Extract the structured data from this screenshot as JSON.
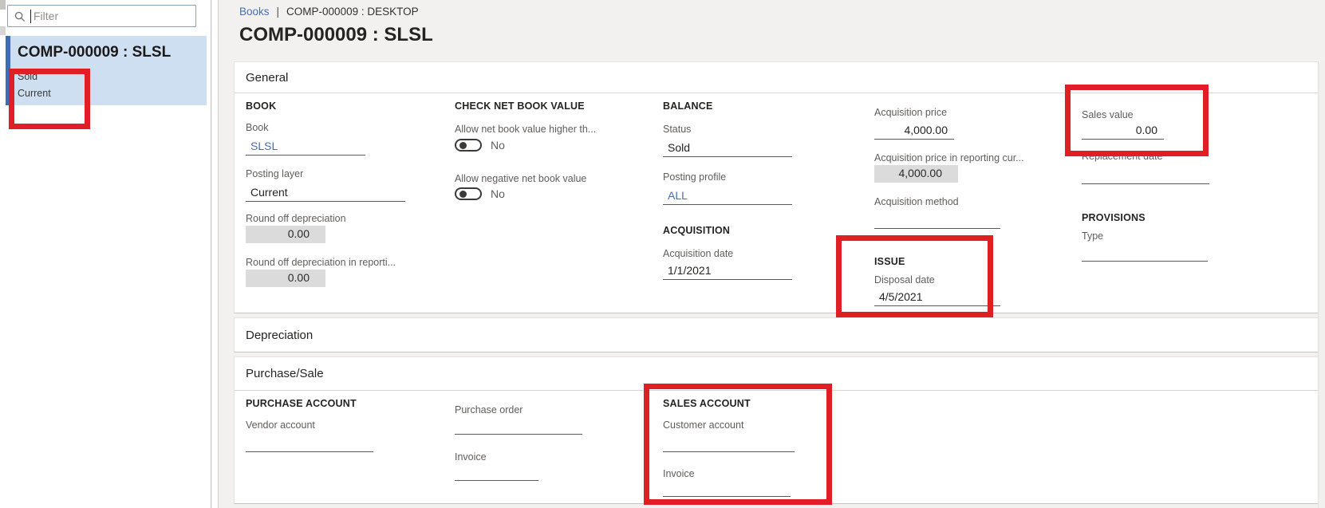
{
  "sidebar": {
    "filter_placeholder": "Filter",
    "selected_item": {
      "title": "COMP-000009 : SLSL",
      "status": "Sold",
      "layer": "Current"
    }
  },
  "header": {
    "breadcrumb_link": "Books",
    "breadcrumb_separator": "|",
    "breadcrumb_current": "COMP-000009 : DESKTOP",
    "page_title": "COMP-000009 : SLSL"
  },
  "general": {
    "title": "General",
    "book_header": "BOOK",
    "book_label": "Book",
    "book_value": "SLSL",
    "posting_layer_label": "Posting layer",
    "posting_layer_value": "Current",
    "round_off_label": "Round off depreciation",
    "round_off_value": "0.00",
    "round_off_reporting_label": "Round off depreciation in reporti...",
    "round_off_reporting_value": "0.00",
    "check_nbv_header": "CHECK NET BOOK VALUE",
    "allow_higher_label": "Allow net book value higher th...",
    "allow_higher_value": "No",
    "allow_negative_label": "Allow negative net book value",
    "allow_negative_value": "No",
    "balance_header": "BALANCE",
    "status_label": "Status",
    "status_value": "Sold",
    "posting_profile_label": "Posting profile",
    "posting_profile_value": "ALL",
    "acquisition_header": "ACQUISITION",
    "acquisition_date_label": "Acquisition date",
    "acquisition_date_value": "1/1/2021",
    "acquisition_price_label": "Acquisition price",
    "acquisition_price_value": "4,000.00",
    "acquisition_price_reporting_label": "Acquisition price in reporting cur...",
    "acquisition_price_reporting_value": "4,000.00",
    "acquisition_method_label": "Acquisition method",
    "issue_header": "ISSUE",
    "disposal_date_label": "Disposal date",
    "disposal_date_value": "4/5/2021",
    "sales_value_label": "Sales value",
    "sales_value_value": "0.00",
    "replacement_date_label": "Replacement date",
    "provisions_header": "PROVISIONS",
    "type_label": "Type"
  },
  "depreciation": {
    "title": "Depreciation"
  },
  "purchase_sale": {
    "title": "Purchase/Sale",
    "purchase_account_header": "PURCHASE ACCOUNT",
    "vendor_account_label": "Vendor account",
    "purchase_order_label": "Purchase order",
    "invoice_label": "Invoice",
    "sales_account_header": "SALES ACCOUNT",
    "customer_account_label": "Customer account",
    "sales_invoice_label": "Invoice"
  },
  "colors": {
    "annotation_red": "#e01e25",
    "link_blue": "#4a6eb5",
    "selected_item_bg": "#cfdff2",
    "selected_item_accent": "#3e6cb8",
    "page_background": "#f2f1ef"
  }
}
